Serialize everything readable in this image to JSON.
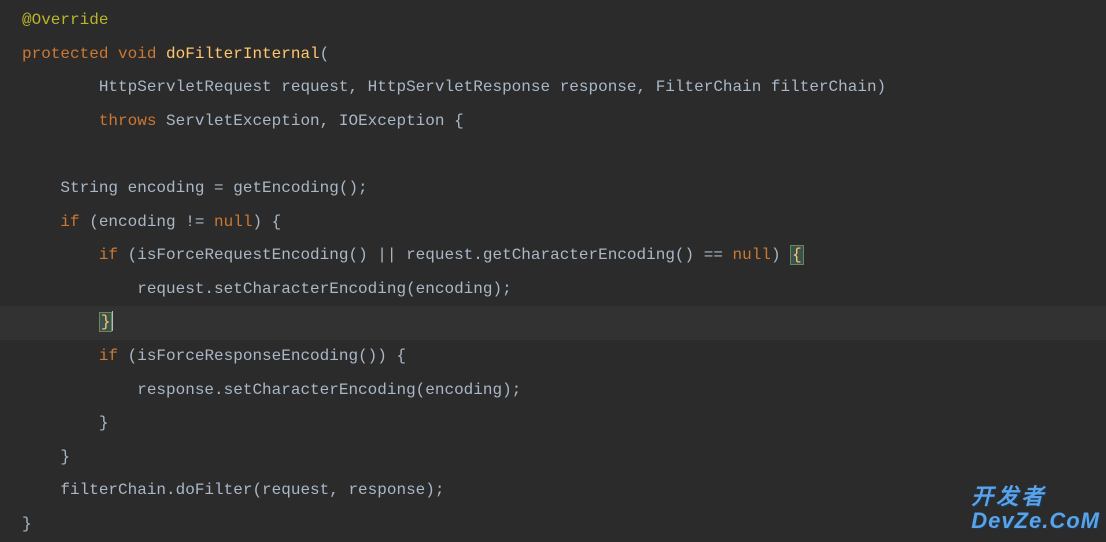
{
  "code": {
    "lines": [
      {
        "indent": 0,
        "tokens": [
          {
            "cls": "annotation",
            "text": "@Override"
          }
        ]
      },
      {
        "indent": 0,
        "tokens": [
          {
            "cls": "keyword",
            "text": "protected void "
          },
          {
            "cls": "method-def",
            "text": "doFilterInternal"
          },
          {
            "cls": "punct",
            "text": "("
          }
        ]
      },
      {
        "indent": 2,
        "tokens": [
          {
            "cls": "type",
            "text": "HttpServletRequest request"
          },
          {
            "cls": "punct",
            "text": ", "
          },
          {
            "cls": "type",
            "text": "HttpServletResponse response"
          },
          {
            "cls": "punct",
            "text": ", "
          },
          {
            "cls": "type",
            "text": "FilterChain filterChain"
          },
          {
            "cls": "punct",
            "text": ")"
          }
        ]
      },
      {
        "indent": 2,
        "tokens": [
          {
            "cls": "keyword",
            "text": "throws "
          },
          {
            "cls": "type",
            "text": "ServletException"
          },
          {
            "cls": "punct",
            "text": ", "
          },
          {
            "cls": "type",
            "text": "IOException "
          },
          {
            "cls": "punct",
            "text": "{"
          }
        ]
      },
      {
        "indent": 0,
        "tokens": []
      },
      {
        "indent": 1,
        "tokens": [
          {
            "cls": "string-type",
            "text": "String encoding = getEncoding();"
          }
        ]
      },
      {
        "indent": 1,
        "tokens": [
          {
            "cls": "keyword",
            "text": "if "
          },
          {
            "cls": "punct",
            "text": "(encoding != "
          },
          {
            "cls": "null-kw",
            "text": "null"
          },
          {
            "cls": "punct",
            "text": ") {"
          }
        ]
      },
      {
        "indent": 2,
        "tokens": [
          {
            "cls": "keyword",
            "text": "if "
          },
          {
            "cls": "punct",
            "text": "(isForceRequestEncoding() || request.getCharacterEncoding() == "
          },
          {
            "cls": "null-kw",
            "text": "null"
          },
          {
            "cls": "punct",
            "text": ") "
          },
          {
            "cls": "brace-highlight",
            "text": "{"
          }
        ]
      },
      {
        "indent": 3,
        "tokens": [
          {
            "cls": "identifier",
            "text": "request.setCharacterEncoding(encoding);"
          }
        ]
      },
      {
        "indent": 2,
        "highlighted": true,
        "caret": true,
        "tokens": [
          {
            "cls": "brace-highlight",
            "text": "}"
          }
        ]
      },
      {
        "indent": 2,
        "tokens": [
          {
            "cls": "keyword",
            "text": "if "
          },
          {
            "cls": "punct",
            "text": "(isForceResponseEncoding()) {"
          }
        ]
      },
      {
        "indent": 3,
        "tokens": [
          {
            "cls": "identifier",
            "text": "response.setCharacterEncoding(encoding);"
          }
        ]
      },
      {
        "indent": 2,
        "tokens": [
          {
            "cls": "punct",
            "text": "}"
          }
        ]
      },
      {
        "indent": 1,
        "tokens": [
          {
            "cls": "punct",
            "text": "}"
          }
        ]
      },
      {
        "indent": 1,
        "tokens": [
          {
            "cls": "identifier",
            "text": "filterChain.doFilter(request"
          },
          {
            "cls": "punct",
            "text": ", "
          },
          {
            "cls": "identifier",
            "text": "response);"
          }
        ]
      },
      {
        "indent": 0,
        "tokens": [
          {
            "cls": "punct",
            "text": "}"
          }
        ]
      }
    ],
    "indentUnit": "    "
  },
  "watermark": {
    "line1": "开发者",
    "line2": "DevZe.CoM"
  }
}
